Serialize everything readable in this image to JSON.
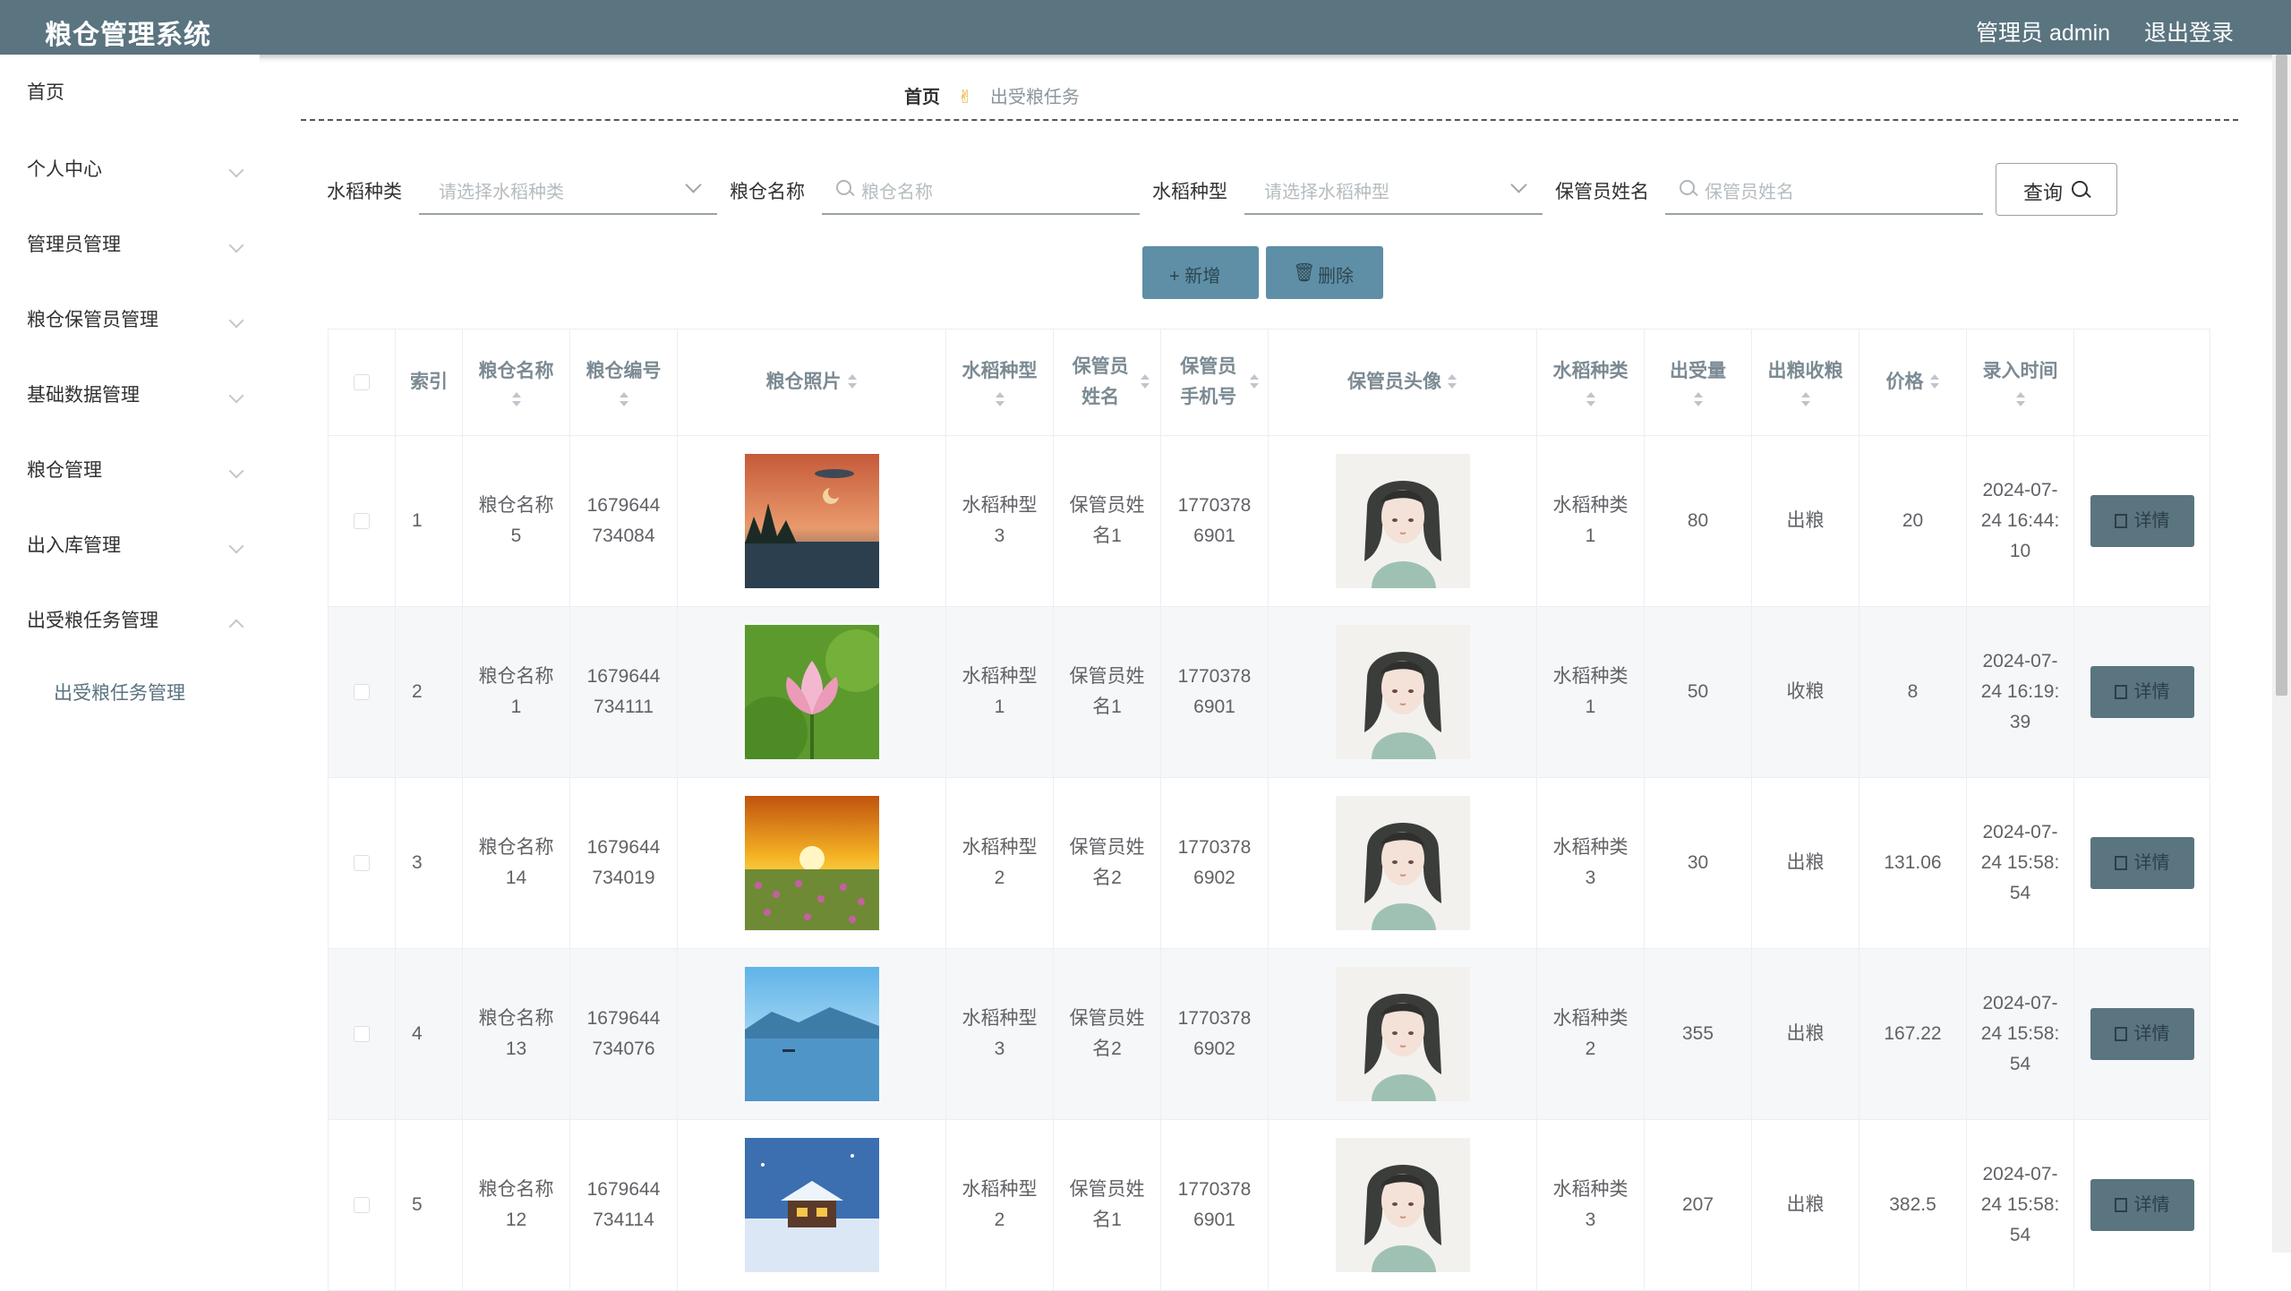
{
  "header": {
    "title": "粮仓管理系统",
    "user": "管理员 admin",
    "logout": "退出登录"
  },
  "sidebar": {
    "items": [
      {
        "label": "首页"
      },
      {
        "label": "个人中心"
      },
      {
        "label": "管理员管理"
      },
      {
        "label": "粮仓保管员管理"
      },
      {
        "label": "基础数据管理"
      },
      {
        "label": "粮仓管理"
      },
      {
        "label": "出入库管理"
      },
      {
        "label": "出受粮任务管理"
      }
    ],
    "sub_item": "出受粮任务管理"
  },
  "breadcrumb": {
    "home": "首页",
    "separator": "✌",
    "current": "出受粮任务"
  },
  "search": {
    "rice_kind_label": "水稻种类",
    "rice_kind_placeholder": "请选择水稻种类",
    "granary_name_label": "粮仓名称",
    "granary_name_placeholder": "粮仓名称",
    "rice_type_label": "水稻种型",
    "rice_type_placeholder": "请选择水稻种型",
    "keeper_name_label": "保管员姓名",
    "keeper_name_placeholder": "保管员姓名",
    "query_button": "查询"
  },
  "actions": {
    "add": "+ 新增",
    "delete": "删除"
  },
  "table": {
    "columns": [
      "索引",
      "粮仓名称",
      "粮仓编号",
      "粮仓照片",
      "水稻种型",
      "保管员姓名",
      "保管员手机号",
      "保管员头像",
      "水稻种类",
      "出受量",
      "出粮收粮",
      "价格",
      "录入时间"
    ],
    "detail_label": "详情",
    "rows": [
      {
        "index": "1",
        "name": "粮仓名称5",
        "code": "1679644734084",
        "photo": "lake-sunset",
        "rice_type": "水稻种型3",
        "keeper": "保管员姓名1",
        "phone": "17703786901",
        "rice_kind": "水稻种类1",
        "amount": "80",
        "direction": "出粮",
        "price": "20",
        "time": "2024-07-24 16:44:10"
      },
      {
        "index": "2",
        "name": "粮仓名称1",
        "code": "1679644734111",
        "photo": "lotus",
        "rice_type": "水稻种型1",
        "keeper": "保管员姓名1",
        "phone": "17703786901",
        "rice_kind": "水稻种类1",
        "amount": "50",
        "direction": "收粮",
        "price": "8",
        "time": "2024-07-24 16:19:39"
      },
      {
        "index": "3",
        "name": "粮仓名称14",
        "code": "1679644734019",
        "photo": "sunset-field",
        "rice_type": "水稻种型2",
        "keeper": "保管员姓名2",
        "phone": "17703786902",
        "rice_kind": "水稻种类3",
        "amount": "30",
        "direction": "出粮",
        "price": "131.06",
        "time": "2024-07-24 15:58:54"
      },
      {
        "index": "4",
        "name": "粮仓名称13",
        "code": "1679644734076",
        "photo": "blue-lake",
        "rice_type": "水稻种型3",
        "keeper": "保管员姓名2",
        "phone": "17703786902",
        "rice_kind": "水稻种类2",
        "amount": "355",
        "direction": "出粮",
        "price": "167.22",
        "time": "2024-07-24 15:58:54"
      },
      {
        "index": "5",
        "name": "粮仓名称12",
        "code": "1679644734114",
        "photo": "snow-cabin",
        "rice_type": "水稻种型2",
        "keeper": "保管员姓名1",
        "phone": "17703786901",
        "rice_kind": "水稻种类3",
        "amount": "207",
        "direction": "出粮",
        "price": "382.5",
        "time": "2024-07-24 15:58:54"
      }
    ]
  },
  "colors": {
    "header_bg": "#5a7480",
    "primary_button": "#5e8fa6",
    "detail_button": "#5a7480",
    "breadcrumb_sep": "#e7a824"
  }
}
